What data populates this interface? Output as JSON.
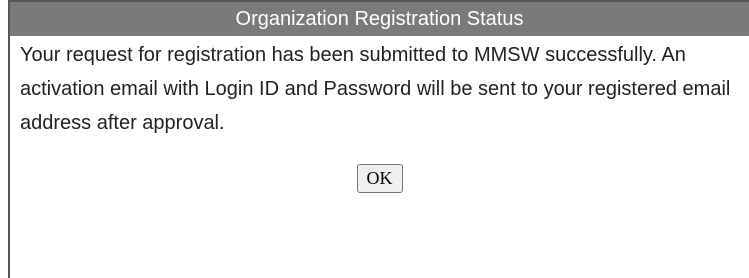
{
  "dialog": {
    "title": "Organization Registration Status",
    "message": "Your request for registration has been submitted to MMSW successfully. An activation email with Login ID and Password will be sent to your registered email address after approval.",
    "ok_label": "OK"
  },
  "colors": {
    "titlebar_bg": "#7a7a7a",
    "titlebar_text": "#ffffff",
    "body_text": "#222222",
    "button_bg": "#efefef"
  }
}
